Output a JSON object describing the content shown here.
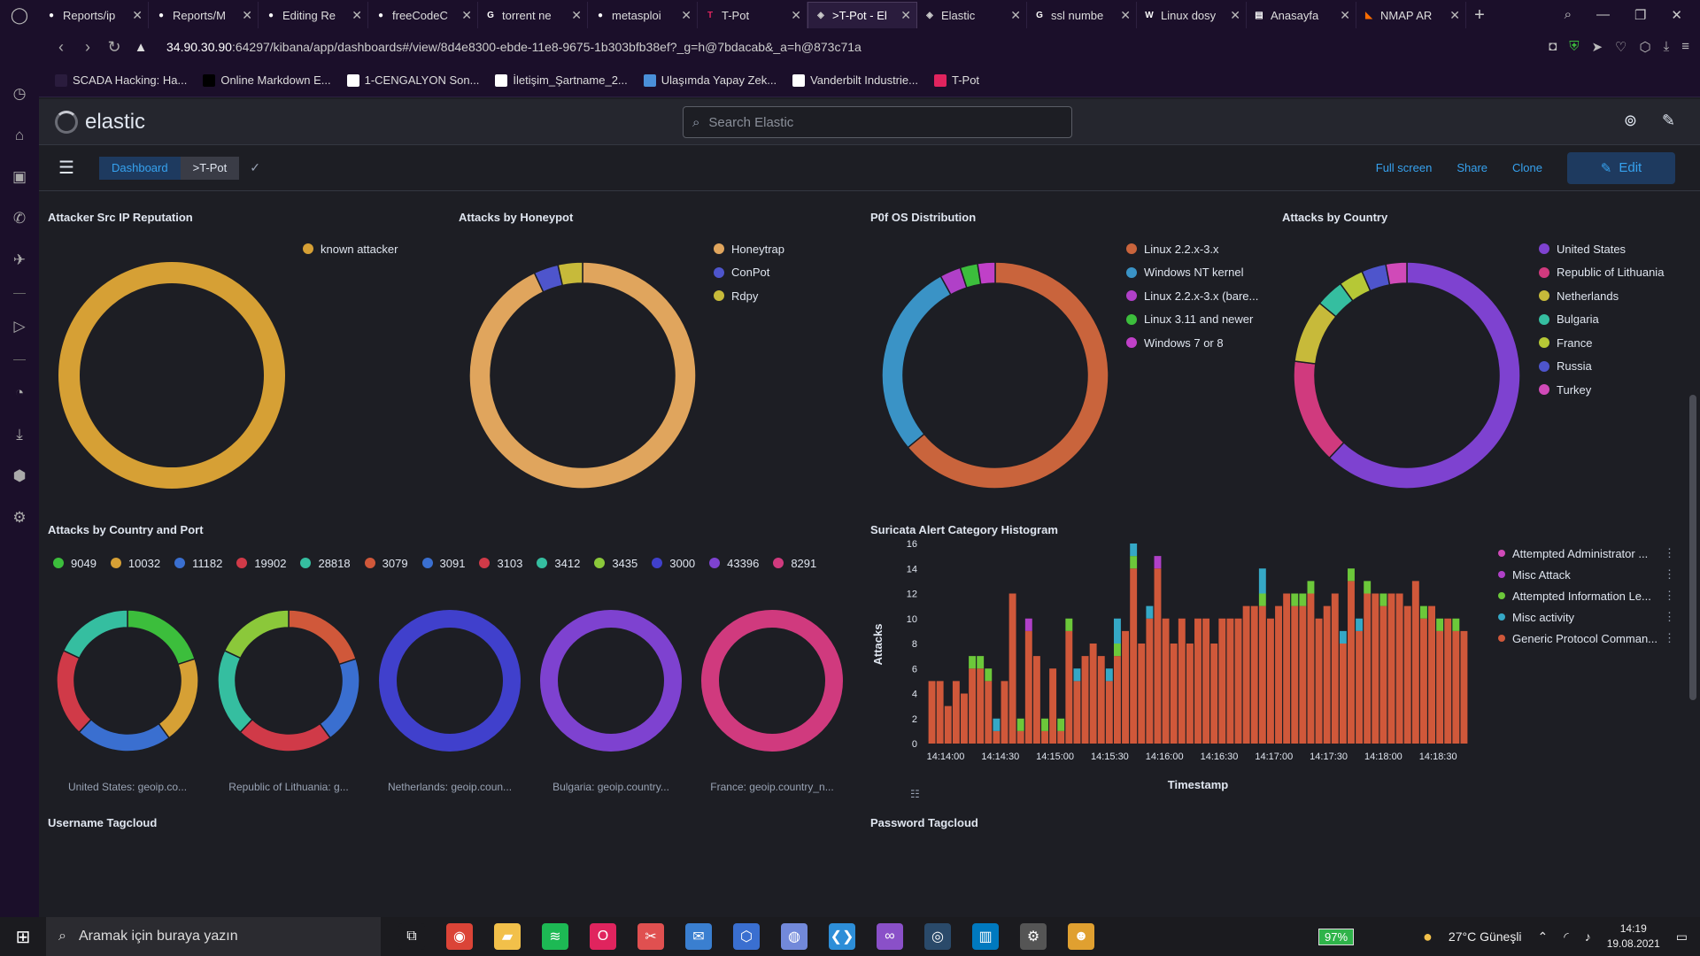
{
  "browser": {
    "tabs": [
      {
        "label": "Reports/ip",
        "icon": "github-icon",
        "color": "#ffffff"
      },
      {
        "label": "Reports/M",
        "icon": "github-icon",
        "color": "#ffffff"
      },
      {
        "label": "Editing Re",
        "icon": "github-icon",
        "color": "#ffffff"
      },
      {
        "label": "freeCodeC",
        "icon": "github-icon",
        "color": "#ffffff"
      },
      {
        "label": "torrent ne",
        "icon": "google-icon",
        "color": "#ffffff"
      },
      {
        "label": "metasploi",
        "icon": "github-icon",
        "color": "#ffffff"
      },
      {
        "label": "T-Pot",
        "icon": "tpot-icon",
        "color": "#e0245e"
      },
      {
        "label": ">T-Pot - El",
        "icon": "kibana-icon",
        "color": "#cccccc"
      },
      {
        "label": "Elastic",
        "icon": "kibana-icon",
        "color": "#cccccc"
      },
      {
        "label": "ssl numbe",
        "icon": "google-icon",
        "color": "#ffffff"
      },
      {
        "label": "Linux dosy",
        "icon": "wiki-icon",
        "color": "#ffffff"
      },
      {
        "label": "Anasayfa",
        "icon": "doc-icon",
        "color": "#ffffff"
      },
      {
        "label": "NMAP AR",
        "icon": "rss-icon",
        "color": "#ff6d00"
      }
    ],
    "active_tab": 7,
    "url_host": "34.90.30.90",
    "url_rest": ":64297/kibana/app/dashboards#/view/8d4e8300-ebde-11e8-9675-1b303bfb38ef?_g=h@7bdacab&_a=h@873c71a",
    "bookmarks": [
      {
        "label": "SCADA Hacking: Ha...",
        "color": "#2a1c3d"
      },
      {
        "label": "Online Markdown E...",
        "color": "#000000"
      },
      {
        "label": "1-CENGALYON Son...",
        "color": "#ffffff"
      },
      {
        "label": "İletişim_Şartname_2...",
        "color": "#ffffff"
      },
      {
        "label": "Ulaşımda Yapay Zek...",
        "color": "#4a90d9"
      },
      {
        "label": "Vanderbilt Industrie...",
        "color": "#ffffff"
      },
      {
        "label": "T-Pot",
        "color": "#e0245e"
      }
    ]
  },
  "kibana": {
    "logo_text": "elastic",
    "search_placeholder": "Search Elastic",
    "breadcrumbs": [
      "Dashboard",
      ">T-Pot"
    ],
    "actions": [
      "Full screen",
      "Share",
      "Clone"
    ],
    "edit_label": "Edit"
  },
  "panels": {
    "src_ip": {
      "title": "Attacker Src IP Reputation"
    },
    "honeypot": {
      "title": "Attacks by Honeypot"
    },
    "p0f": {
      "title": "P0f OS Distribution"
    },
    "country": {
      "title": "Attacks by Country"
    },
    "country_port": {
      "title": "Attacks by Country and Port"
    },
    "suricata": {
      "title": "Suricata Alert Category Histogram"
    },
    "username": {
      "title": "Username Tagcloud"
    },
    "password": {
      "title": "Password Tagcloud"
    }
  },
  "chart_data": [
    {
      "type": "pie",
      "title": "Attacker Src IP Reputation",
      "labels": [
        "known attacker"
      ],
      "values": [
        100
      ],
      "colors": [
        "#d6a035"
      ]
    },
    {
      "type": "pie",
      "title": "Attacks by Honeypot",
      "labels": [
        "Honeytrap",
        "ConPot",
        "Rdpy"
      ],
      "values": [
        93,
        3.5,
        3.5
      ],
      "colors": [
        "#e0a55d",
        "#4e55cc",
        "#c7ba3a"
      ]
    },
    {
      "type": "pie",
      "title": "P0f OS Distribution",
      "labels": [
        "Linux 2.2.x-3.x",
        "Windows NT kernel",
        "Linux 2.2.x-3.x (bare...",
        "Linux 3.11 and newer",
        "Windows 7 or 8"
      ],
      "values": [
        64,
        28,
        3,
        2.5,
        2.5
      ],
      "colors": [
        "#c9643c",
        "#3a93c6",
        "#b040c8",
        "#3cbe3c",
        "#c040c8"
      ]
    },
    {
      "type": "pie",
      "title": "Attacks by Country",
      "labels": [
        "United States",
        "Republic of Lithuania",
        "Netherlands",
        "Bulgaria",
        "France",
        "Russia",
        "Turkey"
      ],
      "values": [
        62,
        15,
        9,
        4,
        3.5,
        3.5,
        3
      ],
      "colors": [
        "#7e42d0",
        "#d03a7e",
        "#c7ba3a",
        "#35bea0",
        "#b6c836",
        "#4e55cc",
        "#d04ab8"
      ]
    },
    {
      "type": "pie",
      "title": "Attacks by Country and Port",
      "legend": [
        {
          "label": "9049",
          "color": "#3cbe3c"
        },
        {
          "label": "10032",
          "color": "#d6a035"
        },
        {
          "label": "11182",
          "color": "#3a6fd0"
        },
        {
          "label": "19902",
          "color": "#d03a48"
        },
        {
          "label": "28818",
          "color": "#35bea0"
        },
        {
          "label": "3079",
          "color": "#d0583a"
        },
        {
          "label": "3091",
          "color": "#3a6fd0"
        },
        {
          "label": "3103",
          "color": "#d03a48"
        },
        {
          "label": "3412",
          "color": "#35bea0"
        },
        {
          "label": "3435",
          "color": "#8bc83a"
        },
        {
          "label": "3000",
          "color": "#4040cc"
        },
        {
          "label": "43396",
          "color": "#7e42d0"
        },
        {
          "label": "8291",
          "color": "#d03a7e"
        }
      ],
      "donuts": [
        {
          "caption": "United States: geoip.co...",
          "values": [
            20,
            20,
            22,
            20,
            18
          ],
          "colors": [
            "#3cbe3c",
            "#d6a035",
            "#3a6fd0",
            "#d03a48",
            "#35bea0"
          ]
        },
        {
          "caption": "Republic of Lithuania: g...",
          "values": [
            20,
            20,
            22,
            20,
            18
          ],
          "colors": [
            "#d0583a",
            "#3a6fd0",
            "#d03a48",
            "#35bea0",
            "#8bc83a"
          ]
        },
        {
          "caption": "Netherlands: geoip.coun...",
          "values": [
            100
          ],
          "colors": [
            "#4040cc"
          ]
        },
        {
          "caption": "Bulgaria: geoip.country...",
          "values": [
            100
          ],
          "colors": [
            "#7e42d0"
          ]
        },
        {
          "caption": "France: geoip.country_n...",
          "values": [
            100
          ],
          "colors": [
            "#d03a7e"
          ]
        }
      ]
    },
    {
      "type": "bar",
      "title": "Suricata Alert Category Histogram",
      "xlabel": "Timestamp",
      "ylabel": "Attacks",
      "y_ticks": [
        0,
        2,
        4,
        6,
        8,
        10,
        12,
        14,
        16
      ],
      "x_ticks": [
        "14:14:00",
        "14:14:30",
        "14:15:00",
        "14:15:30",
        "14:16:00",
        "14:16:30",
        "14:17:00",
        "14:17:30",
        "14:18:00",
        "14:18:30"
      ],
      "legend": [
        {
          "label": "Attempted Administrator ...",
          "color": "#d04ab8"
        },
        {
          "label": "Misc Attack",
          "color": "#b040c8"
        },
        {
          "label": "Attempted Information Le...",
          "color": "#6cc83a"
        },
        {
          "label": "Misc activity",
          "color": "#35a8c6"
        },
        {
          "label": "Generic Protocol Comman...",
          "color": "#d0583a"
        }
      ],
      "series_stack": [
        [
          5,
          0,
          0,
          0,
          0
        ],
        [
          5,
          0,
          0,
          0,
          0
        ],
        [
          3,
          0,
          0,
          0,
          0
        ],
        [
          5,
          0,
          0,
          0,
          0
        ],
        [
          4,
          0,
          0,
          0,
          0
        ],
        [
          6,
          0,
          1,
          0,
          0
        ],
        [
          6,
          0,
          1,
          0,
          0
        ],
        [
          5,
          0,
          1,
          0,
          0
        ],
        [
          1,
          0,
          0,
          1,
          0
        ],
        [
          5,
          0,
          0,
          0,
          0
        ],
        [
          12,
          0,
          0,
          0,
          0
        ],
        [
          1,
          0,
          1,
          0,
          0
        ],
        [
          9,
          1,
          0,
          0,
          0
        ],
        [
          7,
          0,
          0,
          0,
          0
        ],
        [
          1,
          0,
          1,
          0,
          0
        ],
        [
          6,
          0,
          0,
          0,
          0
        ],
        [
          1,
          0,
          1,
          0,
          0
        ],
        [
          9,
          0,
          1,
          0,
          0
        ],
        [
          5,
          0,
          0,
          1,
          0
        ],
        [
          7,
          0,
          0,
          0,
          0
        ],
        [
          8,
          0,
          0,
          0,
          0
        ],
        [
          7,
          0,
          0,
          0,
          0
        ],
        [
          5,
          0,
          0,
          1,
          0
        ],
        [
          7,
          0,
          1,
          2,
          0
        ],
        [
          9,
          0,
          0,
          0,
          0
        ],
        [
          14,
          0,
          1,
          1,
          0
        ],
        [
          8,
          0,
          0,
          0,
          0
        ],
        [
          10,
          0,
          0,
          1,
          0
        ],
        [
          14,
          1,
          0,
          0,
          0
        ],
        [
          10,
          0,
          0,
          0,
          0
        ],
        [
          8,
          0,
          0,
          0,
          0
        ],
        [
          10,
          0,
          0,
          0,
          0
        ],
        [
          8,
          0,
          0,
          0,
          0
        ],
        [
          10,
          0,
          0,
          0,
          0
        ],
        [
          10,
          0,
          0,
          0,
          0
        ],
        [
          8,
          0,
          0,
          0,
          0
        ],
        [
          10,
          0,
          0,
          0,
          0
        ],
        [
          10,
          0,
          0,
          0,
          0
        ],
        [
          10,
          0,
          0,
          0,
          0
        ],
        [
          11,
          0,
          0,
          0,
          0
        ],
        [
          11,
          0,
          0,
          0,
          0
        ],
        [
          11,
          0,
          1,
          2,
          0
        ],
        [
          10,
          0,
          0,
          0,
          0
        ],
        [
          11,
          0,
          0,
          0,
          0
        ],
        [
          12,
          0,
          0,
          0,
          0
        ],
        [
          11,
          0,
          1,
          0,
          0
        ],
        [
          11,
          0,
          1,
          0,
          0
        ],
        [
          12,
          0,
          1,
          0,
          0
        ],
        [
          10,
          0,
          0,
          0,
          0
        ],
        [
          11,
          0,
          0,
          0,
          0
        ],
        [
          12,
          0,
          0,
          0,
          0
        ],
        [
          8,
          0,
          0,
          1,
          0
        ],
        [
          13,
          0,
          1,
          0,
          0
        ],
        [
          9,
          0,
          0,
          1,
          0
        ],
        [
          12,
          0,
          1,
          0,
          0
        ],
        [
          12,
          0,
          0,
          0,
          0
        ],
        [
          11,
          0,
          1,
          0,
          0
        ],
        [
          12,
          0,
          0,
          0,
          0
        ],
        [
          12,
          0,
          0,
          0,
          0
        ],
        [
          11,
          0,
          0,
          0,
          0
        ],
        [
          13,
          0,
          0,
          0,
          0
        ],
        [
          10,
          0,
          1,
          0,
          0
        ],
        [
          11,
          0,
          0,
          0,
          0
        ],
        [
          9,
          0,
          1,
          0,
          0
        ],
        [
          10,
          0,
          0,
          0,
          0
        ],
        [
          9,
          0,
          1,
          0,
          0
        ],
        [
          9,
          0,
          0,
          0,
          0
        ]
      ]
    }
  ],
  "sidebar_icons": [
    "speed-dial-icon",
    "extensions-icon",
    "twitch-icon",
    "whatsapp-icon",
    "telegram-icon",
    "player-icon",
    "history-icon",
    "downloads-icon",
    "crypto-icon",
    "settings-icon"
  ],
  "taskbar": {
    "search_placeholder": "Aramak için buraya yazın",
    "battery": "97%",
    "weather": "27°C  Güneşli",
    "time": "14:19",
    "date": "19.08.2021",
    "apps": [
      {
        "icon": "task-view-icon",
        "color": "#1b1b1f"
      },
      {
        "icon": "chrome-icon",
        "color": "#db4437"
      },
      {
        "icon": "explorer-icon",
        "color": "#f2c04a"
      },
      {
        "icon": "spotify-icon",
        "color": "#1db954"
      },
      {
        "icon": "opera-icon",
        "color": "#e0245e"
      },
      {
        "icon": "snip-icon",
        "color": "#e05050"
      },
      {
        "icon": "mail-icon",
        "color": "#3a7fd0"
      },
      {
        "icon": "virtualbox-icon",
        "color": "#3a6fd0"
      },
      {
        "icon": "discord-icon",
        "color": "#7289da"
      },
      {
        "icon": "vscode-icon",
        "color": "#2d8ed8"
      },
      {
        "icon": "visualstudio-icon",
        "color": "#8a50c8"
      },
      {
        "icon": "steam-icon",
        "color": "#2a4a6a"
      },
      {
        "icon": "trello-icon",
        "color": "#0079bf"
      },
      {
        "icon": "settings-icon",
        "color": "#555555"
      },
      {
        "icon": "game-icon",
        "color": "#e0a030"
      }
    ]
  }
}
